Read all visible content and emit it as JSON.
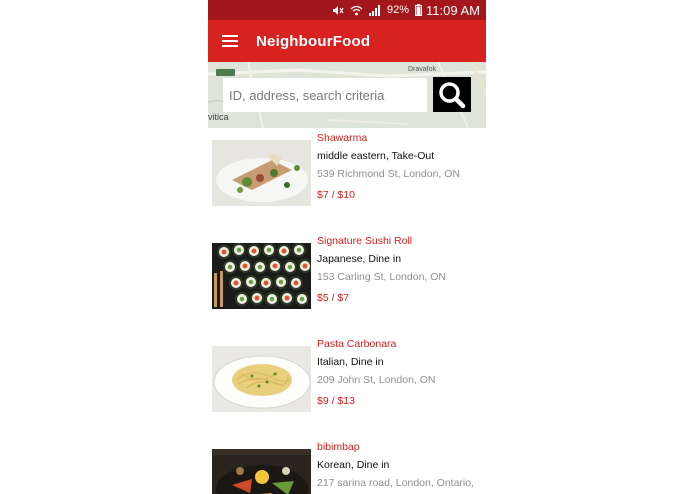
{
  "status_bar": {
    "battery": "92%",
    "time": "11:09 AM"
  },
  "app_bar": {
    "title": "NeighbourFood"
  },
  "map": {
    "labels": [
      "Dravafok",
      "vitica"
    ]
  },
  "search": {
    "placeholder": "ID, address, search criteria"
  },
  "listings": [
    {
      "name": "Shawarma",
      "cuisine": "middle eastern, Take-Out",
      "address": "539 Richmond St, London, ON",
      "price": "$7 / $10",
      "image": "shawarma-wrap-photo"
    },
    {
      "name": "Signature Sushi Roll",
      "cuisine": "Japanese, Dine in",
      "address": "153 Carling St, London, ON",
      "price": "$5 / $7",
      "image": "sushi-roll-platter-photo"
    },
    {
      "name": "Pasta Carbonara",
      "cuisine": "Italian, Dine in",
      "address": "209 John St, London, ON",
      "price": "$9 / $13",
      "image": "spaghetti-plate-photo"
    },
    {
      "name": "bibimbap",
      "cuisine": "Korean, Dine in",
      "address": "217 sarina road, London, Ontario,",
      "price": "",
      "image": "bibimbap-bowl-photo"
    }
  ],
  "colors": {
    "status_bar": "#a3161b",
    "app_bar": "#d7221f",
    "accent_text": "#d21f1b",
    "secondary_text": "#8f8f8f"
  }
}
